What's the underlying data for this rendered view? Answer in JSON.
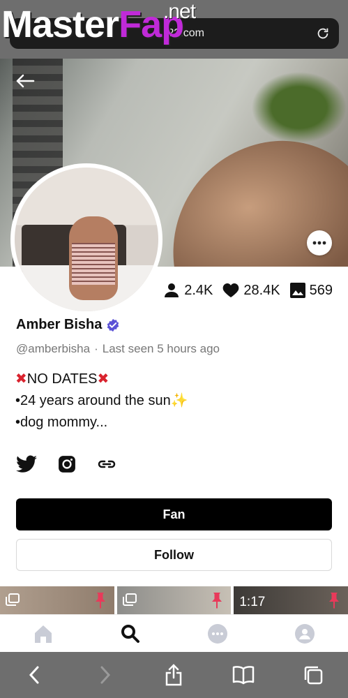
{
  "browser": {
    "url_partial": "f2?.com",
    "watermark": {
      "part1": "Master",
      "part2": "Fap",
      "suffix": ".net"
    }
  },
  "profile": {
    "name": "Amber Bisha",
    "handle": "@amberbisha",
    "last_seen": "Last seen 5 hours ago",
    "stats": {
      "fans": "2.4K",
      "likes": "28.4K",
      "media": "569"
    },
    "bio": {
      "line1": "NO DATES",
      "line2": "•24 years around the sun",
      "line3": "•dog mommy..."
    },
    "verified": true
  },
  "buttons": {
    "fan": "Fan",
    "follow": "Follow"
  },
  "thumbnails": [
    {
      "type": "gallery",
      "pinned": true
    },
    {
      "type": "gallery",
      "pinned": true
    },
    {
      "type": "video",
      "duration": "1:17",
      "pinned": true
    }
  ],
  "nav": {
    "active": "search"
  },
  "colors": {
    "verified": "#5b52d6",
    "x_mark": "#d9232e",
    "fan_button": "#000000",
    "watermark_accent": "#c02ad8"
  }
}
